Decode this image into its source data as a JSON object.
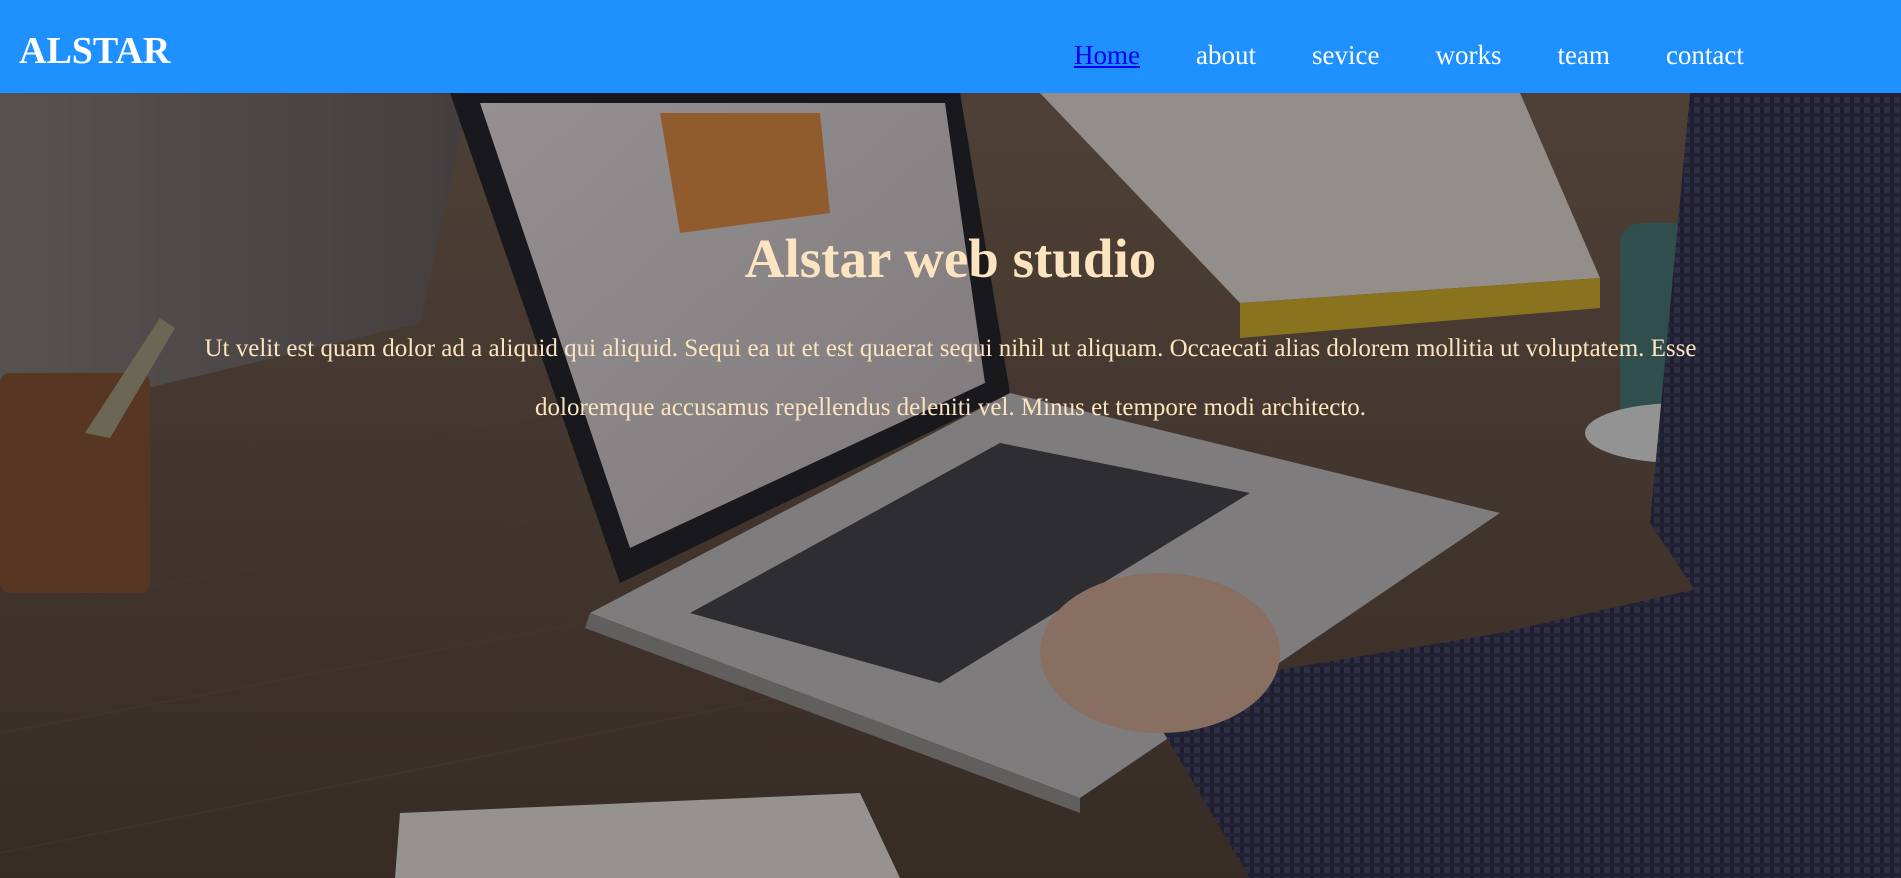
{
  "header": {
    "brand": "ALSTAR",
    "nav": [
      {
        "label": "Home",
        "active": true
      },
      {
        "label": "about",
        "active": false
      },
      {
        "label": "sevice",
        "active": false
      },
      {
        "label": "works",
        "active": false
      },
      {
        "label": "team",
        "active": false
      },
      {
        "label": "contact",
        "active": false
      }
    ],
    "colors": {
      "bar": "#1e90ff",
      "text": "#ffffff",
      "active_link": "#0000ee"
    }
  },
  "hero": {
    "title": "Alstar web studio",
    "paragraph": "Ut velit est quam dolor ad a aliquid qui aliquid. Sequi ea ut et est quaerat sequi nihil ut aliquam. Occaecati alias dolorem mollitia ut voluptatem. Esse doloremque accusamus repellendus deleniti vel. Minus et tempore modi architecto.",
    "text_color": "#fde4c0",
    "background_image": "laptop-on-desk-photo"
  }
}
